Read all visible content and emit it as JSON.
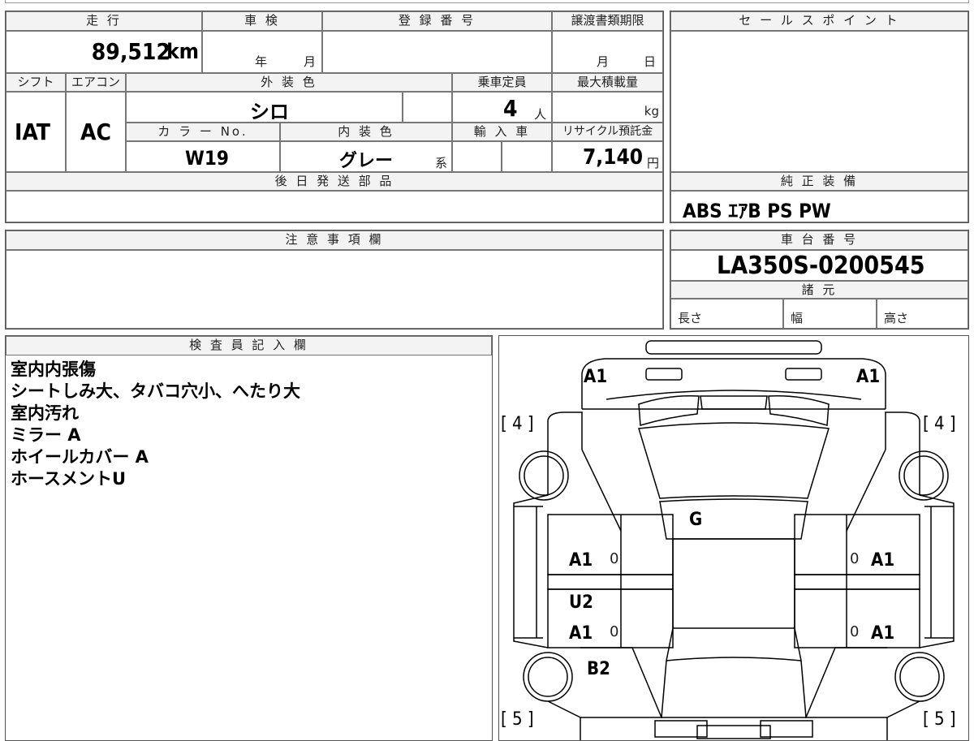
{
  "vehicle": {
    "mileage_label": "走 行",
    "mileage": "89,512",
    "mileage_unit": "km",
    "inspection_label": "車 検",
    "inspection_year": "年",
    "inspection_month": "月",
    "registration_label": "登 録 番 号",
    "transfer_label": "譲渡書類期限",
    "transfer_month": "月",
    "transfer_day": "日",
    "shift_label": "シフト",
    "shift": "IAT",
    "ac_label": "エアコン",
    "ac": "AC",
    "exterior_label": "外 装 色",
    "exterior_color": "シロ",
    "capacity_label": "乗車定員",
    "capacity": "4",
    "capacity_unit": "人",
    "max_load_label": "最大積載量",
    "max_load_unit": "kg",
    "color_no_label": "カ ラ ー No.",
    "color_no": "W19",
    "interior_label": "内 装 色",
    "interior_color": "グレー",
    "interior_suffix": "系",
    "import_label": "輸 入 車",
    "recycle_label": "リサイクル預託金",
    "recycle_fee": "7,140",
    "recycle_unit": "円",
    "later_parts_label": "後 日 発 送 部 品"
  },
  "sales_point_label": "セ ー ル ス ポ イ ン ト",
  "equipment": {
    "label": "純 正 装 備",
    "items": "ABS ｴｱB PS PW"
  },
  "notes_label": "注 意 事 項 欄",
  "chassis": {
    "label": "車 台 番 号",
    "number": "LA350S-0200545"
  },
  "specs": {
    "label": "諸 元",
    "length": "長さ",
    "width": "幅",
    "height": "高さ"
  },
  "inspector": {
    "label": "検 査 員 記 入 欄",
    "lines": [
      "室内内張傷",
      "シートしみ大、タバコ穴小、へたり大",
      "室内汚れ",
      "ミラー A",
      "ホイールカバー A",
      "ホースメントU"
    ]
  },
  "diagram": {
    "front_left": "A1",
    "front_right": "A1",
    "tire_front_left": "[ 4 ]",
    "tire_front_right": "[ 4 ]",
    "tire_rear_left": "[ 5 ]",
    "tire_rear_right": "[ 5 ]",
    "windshield": "G",
    "front_door_left": "A1",
    "front_door_right": "A1",
    "rear_door_left_1": "U2",
    "rear_door_left_2": "A1",
    "rear_door_right": "A1",
    "rear_fender_left": "B2",
    "zero_1": "0",
    "zero_2": "0",
    "zero_3": "0",
    "zero_4": "0"
  }
}
